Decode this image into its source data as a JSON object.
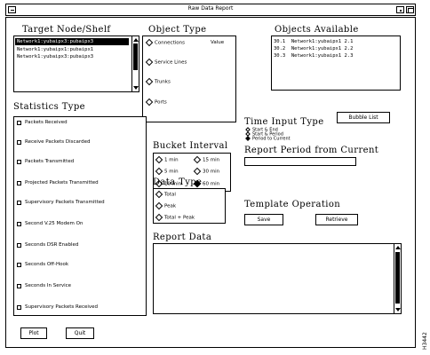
{
  "window": {
    "title": "Raw Data Report"
  },
  "target_node": {
    "heading": "Target Node/Shelf",
    "items": [
      "Network1:yubaipx3:pubaipx3",
      "Network1:yubaipx1:pubaipx1",
      "Network1:yubaipx3:pubaipx3"
    ],
    "selected_index": 0
  },
  "object_type": {
    "heading": "Object Type",
    "items": [
      "Connections",
      "Service Lines",
      "Trunks",
      "Ports"
    ],
    "value_label": "Value"
  },
  "objects_available": {
    "heading": "Objects Available",
    "items": [
      {
        "id": "30.1",
        "name": "Network1:yubaipx1 2.1"
      },
      {
        "id": "30.2",
        "name": "Network1:yubaipx1 2.2"
      },
      {
        "id": "30.3",
        "name": "Network1:yubaipx1 2.3"
      }
    ]
  },
  "statistics_type": {
    "heading": "Statistics Type",
    "items": [
      "Packets Received",
      "Receive Packets Discarded",
      "Packets Transmitted",
      "Projected Packets Transmitted",
      "Supervisory Packets Transmitted",
      "Second V.25 Modem On",
      "Seconds DSR Enabled",
      "Seconds Off-Hook",
      "Seconds In Service",
      "Supervisory Packets Received"
    ]
  },
  "bucket_interval": {
    "heading": "Bucket Interval",
    "options": [
      {
        "label": "1 min",
        "selected": false
      },
      {
        "label": "15 min",
        "selected": false
      },
      {
        "label": "5 min",
        "selected": false
      },
      {
        "label": "30 min",
        "selected": false
      },
      {
        "label": "10 min",
        "selected": false
      },
      {
        "label": "60 min",
        "selected": true
      }
    ]
  },
  "time_input_type": {
    "heading": "Time Input Type",
    "options": [
      "Start & End",
      "Start & Period",
      "Period to Current"
    ],
    "bubble_button": "Bubble List"
  },
  "report_period": {
    "heading": "Report Period from Current",
    "value": ""
  },
  "data_type": {
    "heading": "Data Type",
    "options": [
      "Total",
      "Peak",
      "Total + Peak"
    ]
  },
  "template_operation": {
    "heading": "Template Operation",
    "save_label": "Save",
    "retrieve_label": "Retrieve"
  },
  "report_data": {
    "heading": "Report Data",
    "content": ""
  },
  "footer": {
    "plot_label": "Plot",
    "quit_label": "Quit"
  },
  "figure_id": "H3442"
}
